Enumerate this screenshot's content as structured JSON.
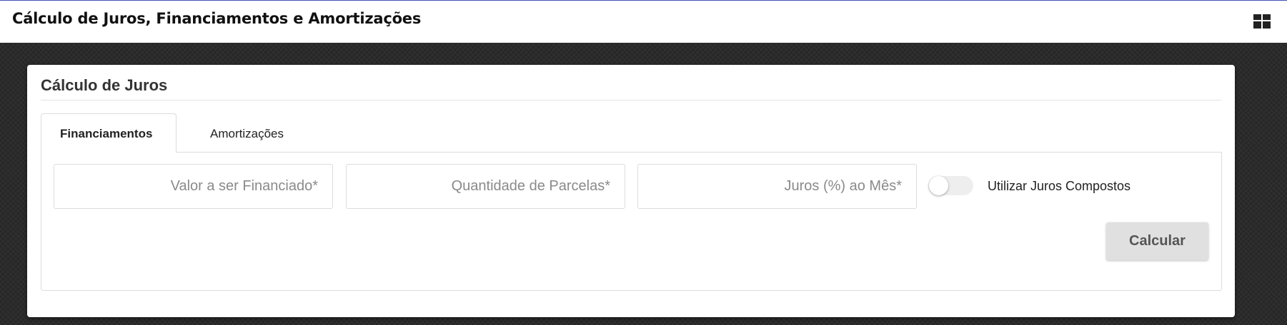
{
  "app": {
    "title": "Cálculo de Juros, Financiamentos e Amortizações",
    "menu_icon": "grid-layout-icon"
  },
  "card": {
    "title": "Cálculo de Juros"
  },
  "tabs": [
    {
      "label": "Financiamentos",
      "active": true
    },
    {
      "label": "Amortizações",
      "active": false
    }
  ],
  "form": {
    "valor": {
      "value": "",
      "placeholder": "Valor a ser Financiado*"
    },
    "parcelas": {
      "value": "",
      "placeholder": "Quantidade de Parcelas*"
    },
    "juros": {
      "value": "",
      "placeholder": "Juros (%) ao Mês*"
    },
    "compostos": {
      "label": "Utilizar Juros Compostos",
      "checked": false
    },
    "submit_label": "Calcular"
  },
  "colors": {
    "topbar_accent": "#3f51b5",
    "background": "#2b2b2b",
    "button_bg": "#e0e0e0"
  }
}
